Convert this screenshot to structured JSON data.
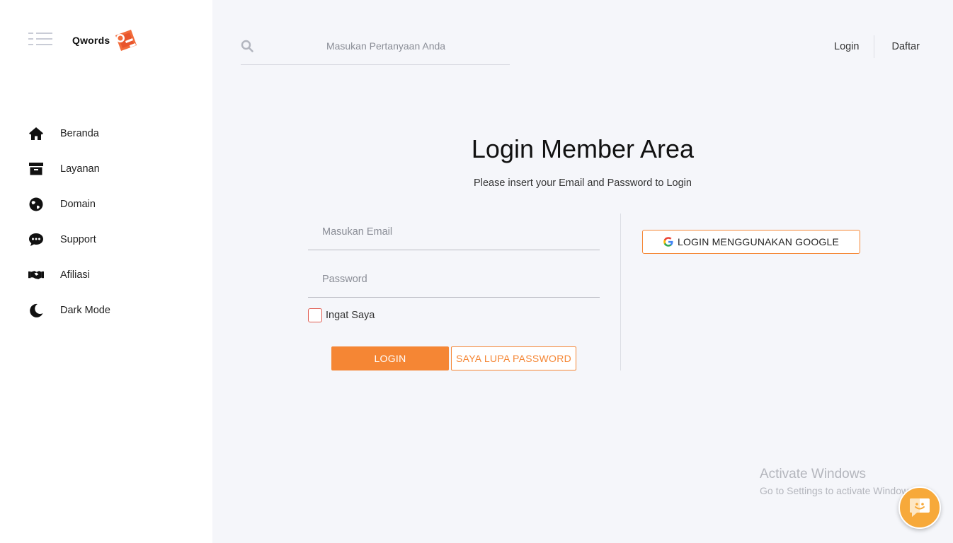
{
  "brand": {
    "name": "Qwords"
  },
  "sidebar": {
    "items": [
      {
        "label": "Beranda",
        "icon": "home-icon"
      },
      {
        "label": "Layanan",
        "icon": "archive-box-icon"
      },
      {
        "label": "Domain",
        "icon": "globe-icon"
      },
      {
        "label": "Support",
        "icon": "chat-bubble-icon"
      },
      {
        "label": "Afiliasi",
        "icon": "handshake-icon"
      },
      {
        "label": "Dark Mode",
        "icon": "moon-icon"
      }
    ]
  },
  "header": {
    "search_placeholder": "Masukan Pertanyaan Anda",
    "login_label": "Login",
    "register_label": "Daftar"
  },
  "main": {
    "title": "Login Member Area",
    "subtitle": "Please insert your Email and Password to Login",
    "email_placeholder": "Masukan Email",
    "password_placeholder": "Password",
    "remember_label": "Ingat Saya",
    "login_button": "LOGIN",
    "forgot_button": "SAYA LUPA PASSWORD",
    "google_button": "LOGIN MENGGUNAKAN GOOGLE"
  },
  "watermark": {
    "title": "Activate Windows",
    "subtitle": "Go to Settings to activate Windows."
  },
  "colors": {
    "accent": "#f58634",
    "sidebar_bg": "#ffffff",
    "main_bg": "#f5f6fa",
    "chat_fab": "#f7a93a"
  }
}
